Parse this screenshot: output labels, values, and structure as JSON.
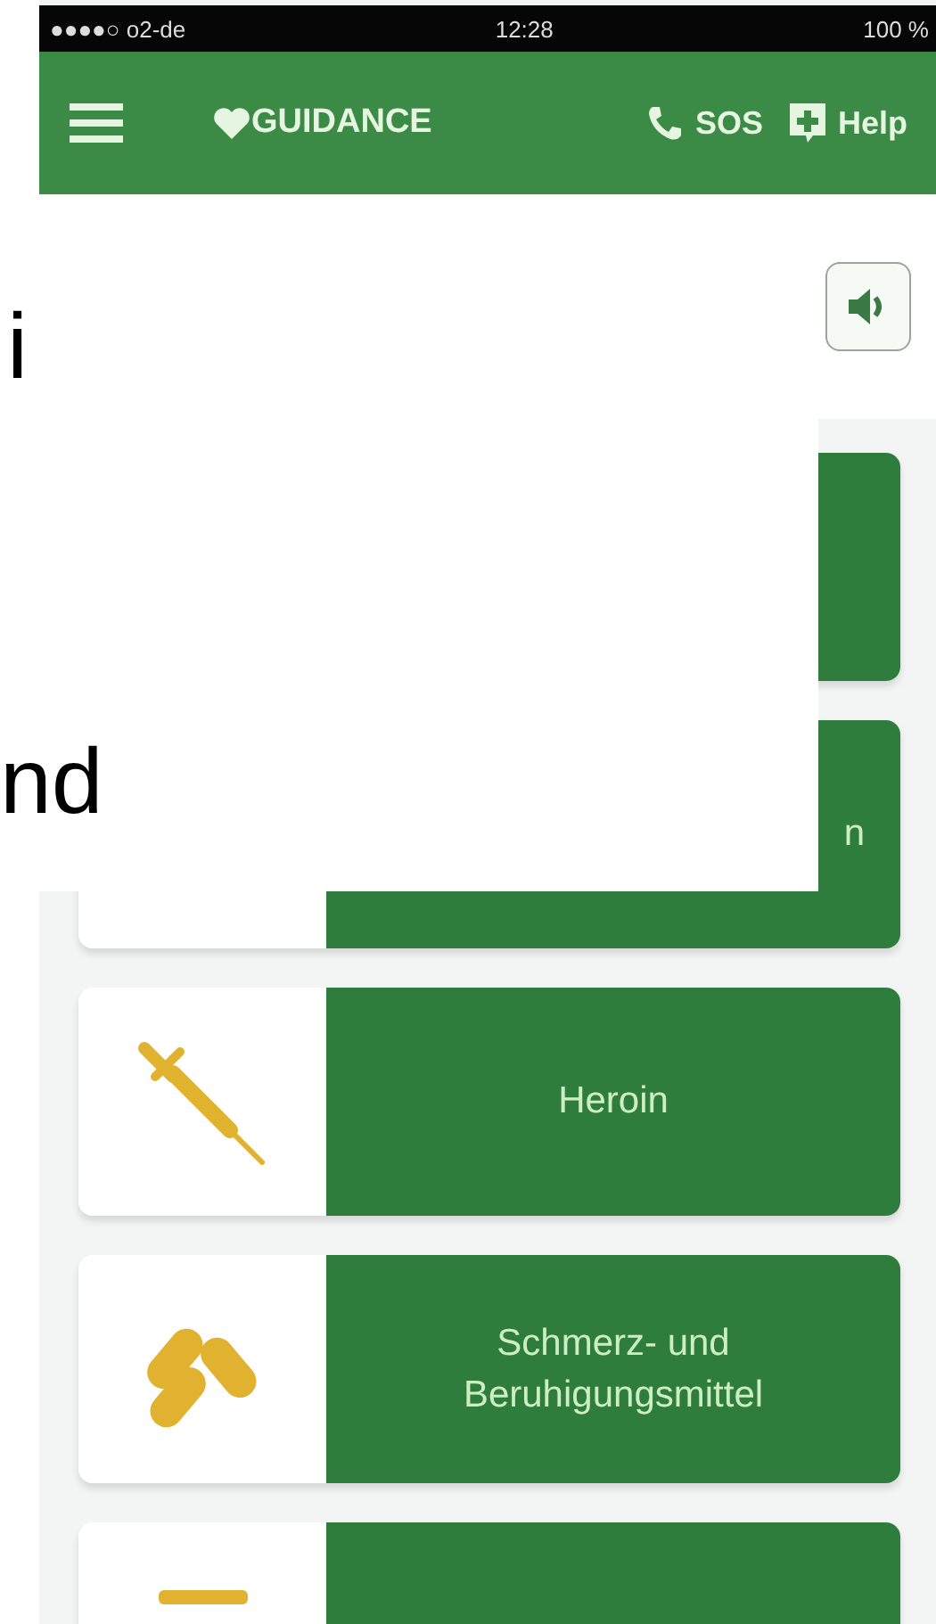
{
  "status_bar": {
    "carrier": "●●●●○ o2-de",
    "time": "12:28",
    "battery": "100 %"
  },
  "header": {
    "title": "GUIDANCE",
    "sos": "SOS",
    "help": "Help"
  },
  "overlay": {
    "lines": [
      "i",
      "nd"
    ]
  },
  "cards": [
    {
      "kind": "hidden"
    },
    {
      "kind": "covered",
      "label": "n"
    },
    {
      "kind": "syringe",
      "label": "Heroin"
    },
    {
      "kind": "pills",
      "label": "Schmerz- und Beruhigungsmittel"
    },
    {
      "kind": "bar"
    }
  ]
}
